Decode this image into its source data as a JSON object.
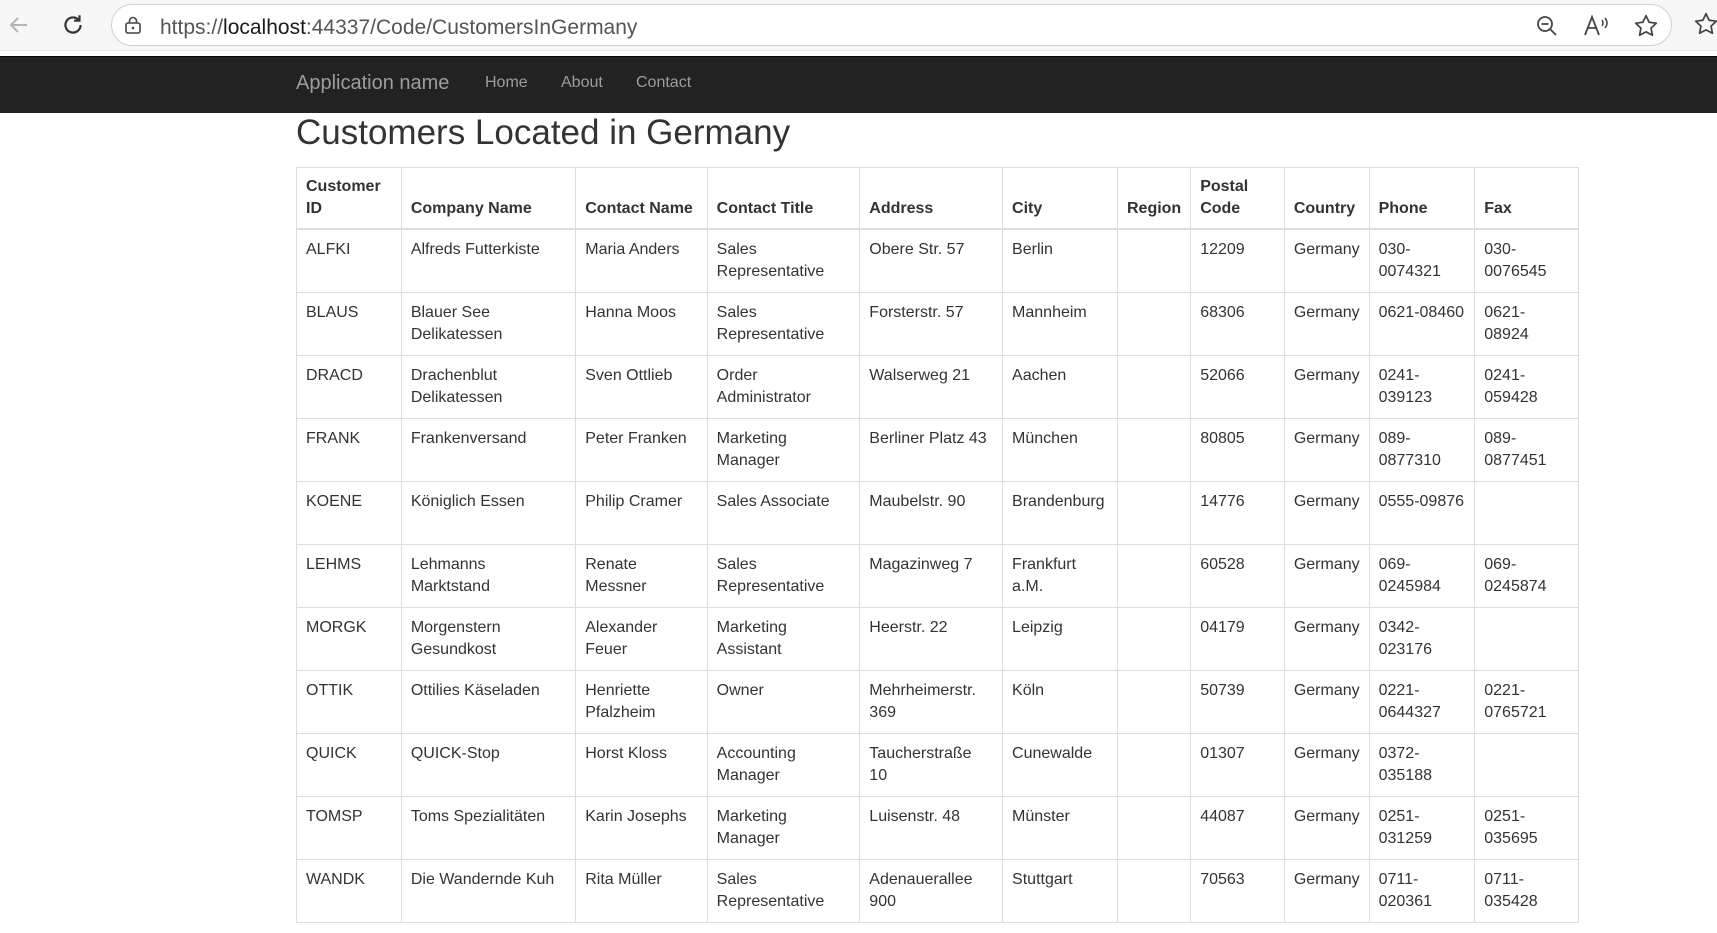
{
  "browser": {
    "url_prefix": "https://",
    "url_host": "localhost",
    "url_rest": ":44337/Code/CustomersInGermany"
  },
  "navbar": {
    "brand": "Application name",
    "links": [
      "Home",
      "About",
      "Contact"
    ]
  },
  "page": {
    "title": "Customers Located in Germany"
  },
  "table": {
    "headers": [
      "Customer ID",
      "Company Name",
      "Contact Name",
      "Contact Title",
      "Address",
      "City",
      "Region",
      "Postal Code",
      "Country",
      "Phone",
      "Fax"
    ],
    "rows": [
      [
        "ALFKI",
        "Alfreds Futterkiste",
        "Maria Anders",
        "Sales Representative",
        "Obere Str. 57",
        "Berlin",
        "",
        "12209",
        "Germany",
        "030-0074321",
        "030-0076545"
      ],
      [
        "BLAUS",
        "Blauer See Delikatessen",
        "Hanna Moos",
        "Sales Representative",
        "Forsterstr. 57",
        "Mannheim",
        "",
        "68306",
        "Germany",
        "0621-08460",
        "0621-08924"
      ],
      [
        "DRACD",
        "Drachenblut Delikatessen",
        "Sven Ottlieb",
        "Order Administrator",
        "Walserweg 21",
        "Aachen",
        "",
        "52066",
        "Germany",
        "0241-039123",
        "0241-059428"
      ],
      [
        "FRANK",
        "Frankenversand",
        "Peter Franken",
        "Marketing Manager",
        "Berliner Platz 43",
        "München",
        "",
        "80805",
        "Germany",
        "089-0877310",
        "089-0877451"
      ],
      [
        "KOENE",
        "Königlich Essen",
        "Philip Cramer",
        "Sales Associate",
        "Maubelstr. 90",
        "Brandenburg",
        "",
        "14776",
        "Germany",
        "0555-09876",
        ""
      ],
      [
        "LEHMS",
        "Lehmanns Marktstand",
        "Renate Messner",
        "Sales Representative",
        "Magazinweg 7",
        "Frankfurt a.M.",
        "",
        "60528",
        "Germany",
        "069-0245984",
        "069-0245874"
      ],
      [
        "MORGK",
        "Morgenstern Gesundkost",
        "Alexander Feuer",
        "Marketing Assistant",
        "Heerstr. 22",
        "Leipzig",
        "",
        "04179",
        "Germany",
        "0342-023176",
        ""
      ],
      [
        "OTTIK",
        "Ottilies Käseladen",
        "Henriette Pfalzheim",
        "Owner",
        "Mehrheimerstr. 369",
        "Köln",
        "",
        "50739",
        "Germany",
        "0221-0644327",
        "0221-0765721"
      ],
      [
        "QUICK",
        "QUICK-Stop",
        "Horst Kloss",
        "Accounting Manager",
        "Taucherstraße 10",
        "Cunewalde",
        "",
        "01307",
        "Germany",
        "0372-035188",
        ""
      ],
      [
        "TOMSP",
        "Toms Spezialitäten",
        "Karin Josephs",
        "Marketing Manager",
        "Luisenstr. 48",
        "Münster",
        "",
        "44087",
        "Germany",
        "0251-031259",
        "0251-035695"
      ],
      [
        "WANDK",
        "Die Wandernde Kuh",
        "Rita Müller",
        "Sales Representative",
        "Adenauerallee 900",
        "Stuttgart",
        "",
        "70563",
        "Germany",
        "0711-020361",
        "0711-035428"
      ]
    ]
  }
}
